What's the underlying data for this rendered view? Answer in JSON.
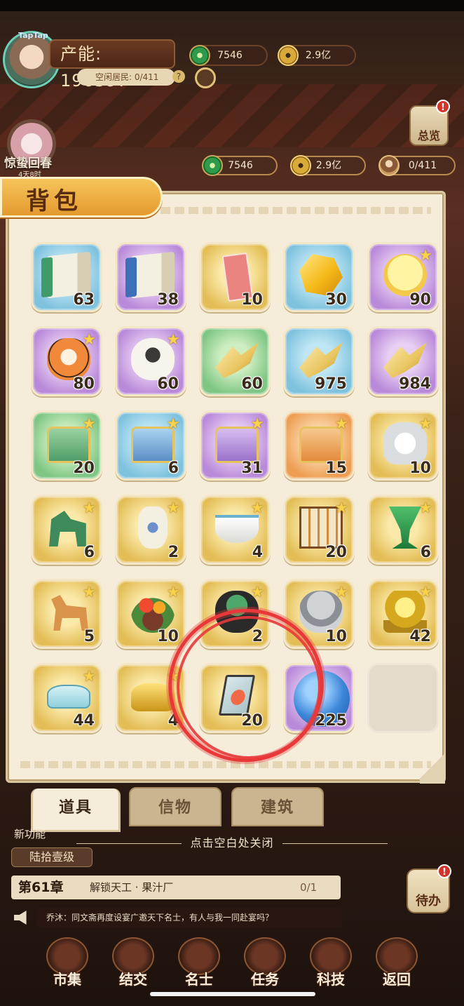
{
  "hud": {
    "brand": "TapTap",
    "production": "产能: 196397",
    "idle_residents": "空闲居民: 0/411",
    "jade": "7546",
    "gold": "2.9亿",
    "overview_label": "总览",
    "overview_badge": "!",
    "event_label": "惊蛰回春",
    "event_time": "4天8时",
    "res_jade": "7546",
    "res_gold": "2.9亿",
    "res_residents": "0/411"
  },
  "backpack": {
    "title": "背包",
    "items": [
      {
        "icon": "green-scroll",
        "color": "blue",
        "count": "63",
        "star": false
      },
      {
        "icon": "blue-scroll",
        "color": "purple",
        "count": "38",
        "star": false
      },
      {
        "icon": "red-ticket",
        "color": "gold",
        "count": "10",
        "star": false
      },
      {
        "icon": "gold-crystal",
        "color": "blue",
        "count": "30",
        "star": false
      },
      {
        "icon": "chick-egg",
        "color": "purple",
        "count": "90",
        "star": true
      },
      {
        "icon": "tiger-figure",
        "color": "purple",
        "count": "80",
        "star": true
      },
      {
        "icon": "sheep-figure",
        "color": "purple",
        "count": "60",
        "star": true
      },
      {
        "icon": "gold-shard",
        "color": "green",
        "count": "60",
        "star": false
      },
      {
        "icon": "gold-shard",
        "color": "blue",
        "count": "975",
        "star": false
      },
      {
        "icon": "gold-shard",
        "color": "purple",
        "count": "984",
        "star": false
      },
      {
        "icon": "green-chest",
        "color": "green",
        "count": "20",
        "star": true
      },
      {
        "icon": "blue-chest",
        "color": "blue",
        "count": "6",
        "star": true
      },
      {
        "icon": "purple-chest",
        "color": "purple",
        "count": "31",
        "star": true
      },
      {
        "icon": "orange-chest",
        "color": "orange",
        "count": "15",
        "star": true
      },
      {
        "icon": "porcelain-jar",
        "color": "gold",
        "count": "10",
        "star": true
      },
      {
        "icon": "jade-dog",
        "color": "gold",
        "count": "6",
        "star": true
      },
      {
        "icon": "blue-white-vase",
        "color": "gold",
        "count": "2",
        "star": true
      },
      {
        "icon": "white-bowl",
        "color": "gold",
        "count": "4",
        "star": true
      },
      {
        "icon": "lantern",
        "color": "gold",
        "count": "20",
        "star": true
      },
      {
        "icon": "jade-cup",
        "color": "gold",
        "count": "6",
        "star": true
      },
      {
        "icon": "tang-horse",
        "color": "gold",
        "count": "5",
        "star": true
      },
      {
        "icon": "flower-arrangement",
        "color": "gold",
        "count": "10",
        "star": true
      },
      {
        "icon": "lotus-pot",
        "color": "gold",
        "count": "2",
        "star": true
      },
      {
        "icon": "stone-lion",
        "color": "gold",
        "count": "10",
        "star": true
      },
      {
        "icon": "golden-tree",
        "color": "gold",
        "count": "42",
        "star": true
      },
      {
        "icon": "jade-comb",
        "color": "gold",
        "count": "44",
        "star": true
      },
      {
        "icon": "gold-ingot",
        "color": "gold",
        "count": "4",
        "star": true
      },
      {
        "icon": "koi-card",
        "color": "gold",
        "count": "20",
        "star": false
      },
      {
        "icon": "blue-orb",
        "color": "purple",
        "count": "225",
        "star": false
      },
      {
        "icon": "empty-slot",
        "color": "empty",
        "count": "",
        "star": false
      }
    ]
  },
  "tabs": [
    {
      "label": "道具"
    },
    {
      "label": "信物"
    },
    {
      "label": "建筑"
    }
  ],
  "close_hint": "点击空白处关闭",
  "lower": {
    "new_power": "新功能",
    "level": "陆拾壹级",
    "chapter_num": "第61章",
    "chapter_task": "解锁天工 · 果汁厂",
    "chapter_progress": "0/1",
    "todo_label": "待办",
    "todo_badge": "!",
    "chat": "乔沐：同文斋再度设宴广邀天下名士，有人与我一同赴宴吗？"
  },
  "nav": [
    {
      "label": "市集"
    },
    {
      "label": "结交"
    },
    {
      "label": "名士"
    },
    {
      "label": "任务"
    },
    {
      "label": "科技"
    },
    {
      "label": "返回"
    }
  ]
}
